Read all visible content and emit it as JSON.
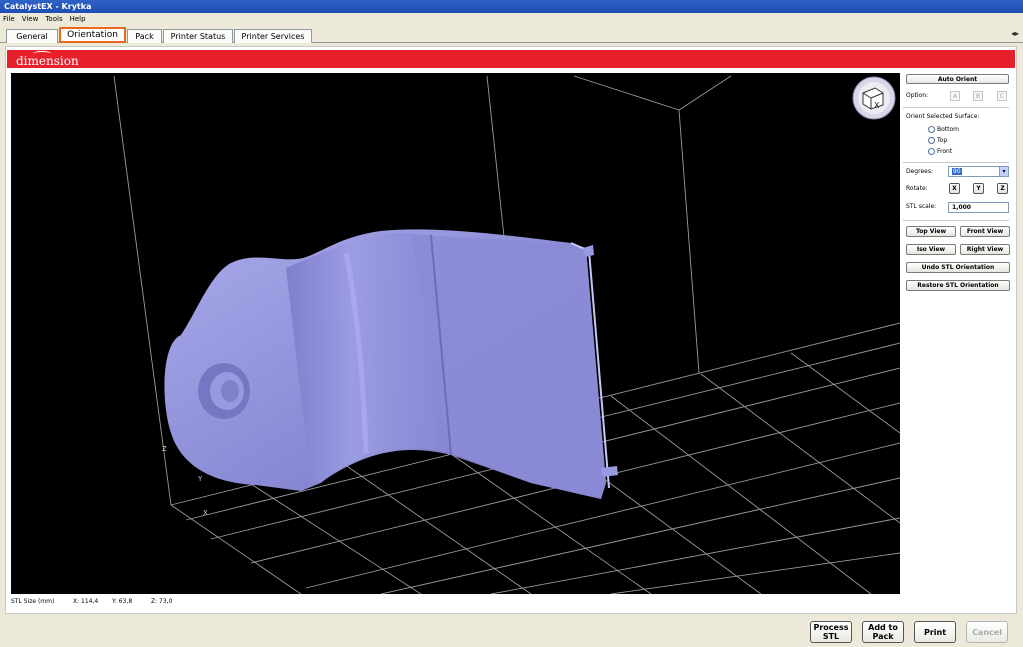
{
  "window": {
    "title": "CatalystEX - Krytka"
  },
  "menu": [
    "File",
    "View",
    "Tools",
    "Help"
  ],
  "tabs": [
    "General",
    "Orientation",
    "Pack",
    "Printer Status",
    "Printer Services"
  ],
  "active_tab": "Orientation",
  "banner": {
    "brand": "dimension",
    "color": "#e8202c"
  },
  "viewport": {
    "background": "#000000",
    "model_color": "#8e8ed8",
    "axis_labels": {
      "x": "X",
      "y": "Y",
      "z": "Z"
    },
    "orientation_cube_label": "X"
  },
  "status": {
    "size_label": "STL Size (mm)",
    "x": "X: 114,4",
    "y": "Y: 63,8",
    "z": "Z: 73,0"
  },
  "sidebar": {
    "auto_orient": "Auto Orient",
    "option_label": "Option:",
    "options": [
      "A",
      "B",
      "C"
    ],
    "orient_surface_label": "Orient Selected Surface:",
    "surfaces": [
      "Bottom",
      "Top",
      "Front"
    ],
    "degrees_label": "Degrees:",
    "degrees_value": "90",
    "rotate_label": "Rotate:",
    "rotate_axes": [
      "X",
      "Y",
      "Z"
    ],
    "stl_scale_label": "STL scale:",
    "stl_scale_value": "1,000",
    "top_view": "Top View",
    "front_view": "Front View",
    "iso_view": "Iso View",
    "right_view": "Right View",
    "undo_orientation": "Undo STL Orientation",
    "restore_orientation": "Restore STL Orientation"
  },
  "actions": {
    "process_stl_1": "Process",
    "process_stl_2": "STL",
    "add_to_pack_1": "Add to",
    "add_to_pack_2": "Pack",
    "print": "Print",
    "cancel": "Cancel"
  }
}
